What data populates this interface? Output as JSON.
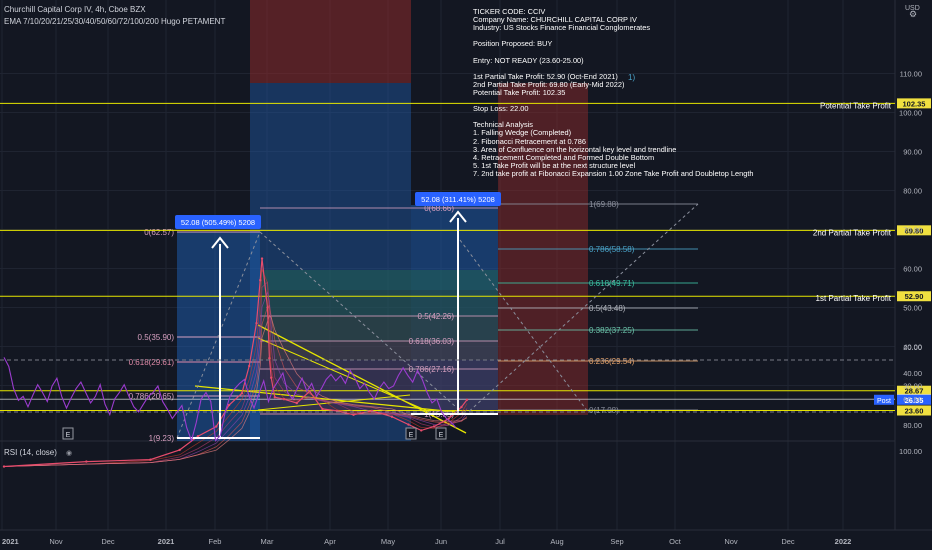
{
  "header": {
    "symbol_line": "Churchill Capital Corp IV, 4h, Cboe BZX",
    "indicator_line": "EMA 7/10/20/21/25/30/40/50/60/72/100/200 Hugo PETAMENT",
    "currency": "USD"
  },
  "colors": {
    "background": "#131722",
    "axis_text": "#b2b5be",
    "price_line": "#e6e600",
    "blue_box": "#1e5aa8",
    "red_box": "#8c2a2a",
    "rsi": "#9b3ccf",
    "post_badge": "#2962ff",
    "guide": "#ffffff"
  },
  "analysis_note": {
    "lines": [
      "TICKER CODE: CCIV",
      "Company Name: CHURCHILL CAPITAL CORP IV",
      "Industry: US Stocks Finance Financial Conglomerates",
      "",
      "Position Proposed: BUY",
      "",
      "Entry: NOT READY (23.60-25.00)",
      "",
      "1st Partial Take Profit: 52.90 (Oct-End 2021)",
      "2nd Partial Take Profit: 69.80 (Early-Mid 2022)",
      "Potential Take Profit: 102.35",
      "",
      "Stop Loss: 22.00",
      "",
      "Technical Analysis",
      "1. Falling Wedge (Completed)",
      "2. Fibonacci Retracement at 0.786",
      "3. Area of Confluence on the horizontal key level and trendline",
      "4. Retracement Completed and Formed Double Bottom",
      "5. 1st Take Profit will be at the next structure level",
      "7. 2nd take profit at Fibonacci Expansion 1.00 Zone Take Profit and Doubletop Length"
    ]
  },
  "chart_data": [
    {
      "type": "line",
      "title": "Churchill Capital Corp IV, 4h, Cboe BZX",
      "y_axis": {
        "ticks": [
          110,
          100,
          90,
          80,
          70,
          60,
          50,
          40,
          30
        ],
        "units": "USD",
        "ylim": [
          5,
          118
        ]
      },
      "x_axis": {
        "tick_labels": [
          "2021",
          "Nov",
          "Dec",
          "2021",
          "Feb",
          "Mar",
          "Apr",
          "May",
          "Jun",
          "Jul",
          "Aug",
          "Sep",
          "Oct",
          "Nov",
          "Dec",
          "2022"
        ]
      },
      "series": [
        {
          "x": [
            "2020-10-01",
            "2020-11-15",
            "2020-12-20",
            "2021-01-05",
            "2021-01-15",
            "2021-01-25",
            "2021-02-01",
            "2021-02-08",
            "2021-02-12",
            "2021-02-16",
            "2021-02-18",
            "2021-02-19",
            "2021-02-22",
            "2021-02-23",
            "2021-02-24",
            "2021-02-26",
            "2021-03-03",
            "2021-03-10",
            "2021-03-17",
            "2021-03-24",
            "2021-04-01",
            "2021-04-10",
            "2021-04-20",
            "2021-05-01",
            "2021-05-10",
            "2021-05-17",
            "2021-05-24",
            "2021-06-01",
            "2021-06-08",
            "2021-06-11"
          ],
          "y": [
            9.23,
            10.5,
            11.0,
            13.5,
            17.0,
            19.5,
            25.0,
            28.0,
            35.0,
            46.0,
            57.0,
            62.57,
            50.0,
            37.0,
            32.0,
            27.0,
            26.5,
            25.5,
            28.5,
            24.0,
            23.5,
            22.5,
            23.5,
            22.0,
            20.0,
            18.5,
            19.5,
            21.5,
            24.5,
            26.35
          ]
        }
      ],
      "price_levels": [
        {
          "value": 102.35,
          "label": "Potential Take Profit",
          "tag": "102.35"
        },
        {
          "value": 69.8,
          "label": "2nd Partial Take Profit",
          "tag": "69.80"
        },
        {
          "value": 52.9,
          "label": "1st Partial Take Profit",
          "tag": "52.90"
        },
        {
          "value": 28.67,
          "label": "",
          "tag": "28.67"
        },
        {
          "value": 26.48,
          "label": "",
          "tag": "26.48"
        },
        {
          "value": 26.35,
          "label": "Post",
          "tag": "26.35"
        },
        {
          "value": 23.6,
          "label": "",
          "tag": "23.60"
        }
      ],
      "fib_retracement_1": [
        {
          "label": "0(62.57)",
          "value": 62.57
        },
        {
          "label": "0.5(35.90)",
          "value": 35.9
        },
        {
          "label": "0.618(29.61)",
          "value": 29.61
        },
        {
          "label": "0.786(20.65)",
          "value": 20.65
        },
        {
          "label": "1(9.23)",
          "value": 9.23
        }
      ],
      "fib_retracement_2": [
        {
          "label": "0(68.66)",
          "value": 68.66
        },
        {
          "label": "0.5(42.26)",
          "value": 42.26
        },
        {
          "label": "0.618(36.03)",
          "value": 36.03
        },
        {
          "label": "0.786(27.16)",
          "value": 27.16
        },
        {
          "label": "1(15.85)",
          "value": 15.85
        }
      ],
      "fib_extension": [
        {
          "label": "1(69.88)",
          "value": 69.88
        },
        {
          "label": "0.786(58.58)",
          "value": 58.58
        },
        {
          "label": "0.618(49.71)",
          "value": 49.71
        },
        {
          "label": "0.5(43.48)",
          "value": 43.48
        },
        {
          "label": "0.382(37.25)",
          "value": 37.25
        },
        {
          "label": "0.236(29.54)",
          "value": 29.54
        },
        {
          "label": "0(17.08)",
          "value": 17.08
        }
      ],
      "measurements": [
        {
          "label": "52.08 (505.49%) 5208"
        },
        {
          "label": "52.08 (311.41%) 5208"
        }
      ],
      "earnings_markers": [
        "E",
        "E",
        "E"
      ],
      "hidden_label_fragment": "1)"
    },
    {
      "type": "line",
      "title": "RSI (14, close)",
      "y_axis": {
        "ticks": [
          100,
          80,
          60,
          40,
          20
        ],
        "ylim": [
          15,
          105
        ],
        "bands": [
          70,
          30
        ]
      },
      "series": [
        {
          "name": "RSI (14, close)",
          "values": [
            28,
            35,
            52,
            61,
            58,
            66,
            57,
            49,
            55,
            62,
            50,
            44,
            58,
            67,
            59,
            52,
            47,
            55,
            63,
            58,
            49,
            64,
            72,
            60,
            55,
            49,
            58,
            66,
            70,
            64,
            58,
            55,
            50,
            62,
            68,
            75,
            70,
            65,
            82,
            92,
            78,
            60,
            55,
            62,
            92,
            88,
            70,
            58,
            52,
            48,
            45,
            58,
            67,
            56,
            46,
            62,
            52,
            46,
            40,
            55,
            60,
            52,
            44,
            54,
            48,
            58,
            52,
            45,
            41,
            46,
            42,
            48,
            38,
            44,
            52,
            48,
            55,
            60,
            52,
            47,
            52,
            50,
            42,
            36,
            42,
            47,
            38,
            45,
            55,
            63,
            60,
            70,
            75,
            78,
            82
          ]
        }
      ]
    }
  ]
}
